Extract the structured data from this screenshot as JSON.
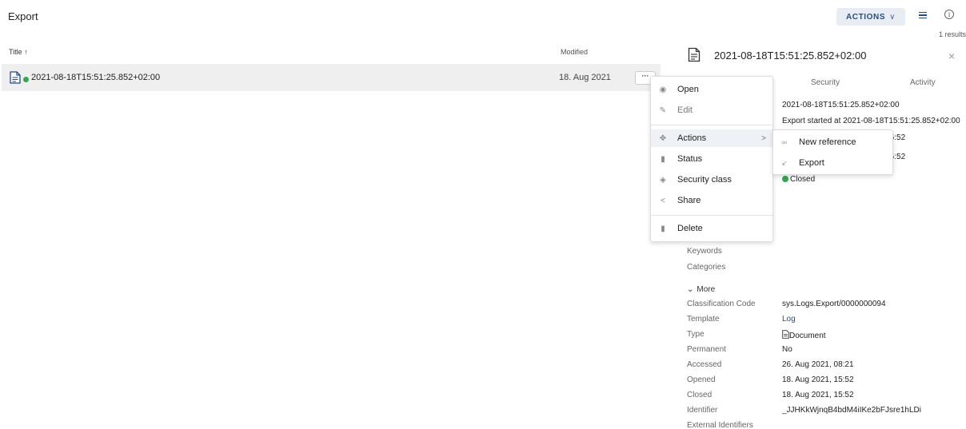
{
  "header": {
    "title": "Export",
    "actions_label": "ACTIONS",
    "actions_chevron": "∨",
    "results": "1 results"
  },
  "list": {
    "col_title": "Title ↑",
    "col_modified": "Modified",
    "rows": [
      {
        "title": "2021-08-18T15:51:25.852+02:00",
        "modified": "18. Aug 2021",
        "status_color": "#2fa84f",
        "more_label": "···"
      }
    ]
  },
  "details": {
    "title": "2021-08-18T15:51:25.852+02:00",
    "close": "×",
    "tabs": [
      "Security",
      "Activity"
    ],
    "top_values": {
      "title_value": "2021-08-18T15:51:25.852+02:00",
      "description_value": "Export started at 2021-08-18T15:51:25.852+02:00",
      "date1": "1, 15:52",
      "date2": "1, 15:52",
      "status": "Closed"
    },
    "keywords_label": "Keywords",
    "categories_label": "Categories",
    "more_toggle": "More",
    "more_chevron": "⌄",
    "fields": [
      {
        "label": "Classification Code",
        "value": "sys.Logs.Export/0000000094"
      },
      {
        "label": "Template",
        "value": "Log"
      },
      {
        "label": "Type",
        "value": "Document"
      },
      {
        "label": "Permanent",
        "value": "No"
      },
      {
        "label": "Accessed",
        "value": "26. Aug 2021, 08:21"
      },
      {
        "label": "Opened",
        "value": "18. Aug 2021, 15:52"
      },
      {
        "label": "Closed",
        "value": "18. Aug 2021, 15:52"
      },
      {
        "label": "Identifier",
        "value": "_JJHKkWjnqB4bdM4iIKe2bFJsre1hLDi"
      },
      {
        "label": "External Identifiers",
        "value": ""
      }
    ]
  },
  "context_menu": {
    "items": [
      {
        "label": "Open",
        "icon": "eye-icon",
        "glyph": "◉"
      },
      {
        "label": "Edit",
        "icon": "pencil-icon",
        "glyph": "✎"
      },
      {
        "label": "Actions",
        "icon": "move-icon",
        "glyph": "✥",
        "arrow": ">"
      },
      {
        "label": "Status",
        "icon": "lock-icon",
        "glyph": "▮"
      },
      {
        "label": "Security class",
        "icon": "shield-icon",
        "glyph": "◈"
      },
      {
        "label": "Share",
        "icon": "share-icon",
        "glyph": "<"
      },
      {
        "label": "Delete",
        "icon": "trash-icon",
        "glyph": "▮"
      }
    ]
  },
  "submenu": {
    "items": [
      {
        "label": "New reference",
        "icon": "link-icon",
        "glyph": "∞"
      },
      {
        "label": "Export",
        "icon": "export-arrow-icon",
        "glyph": "↙"
      }
    ]
  },
  "colors": {
    "accent": "#1f4e8c",
    "success": "#2fa84f",
    "row_bg": "#efefef"
  }
}
